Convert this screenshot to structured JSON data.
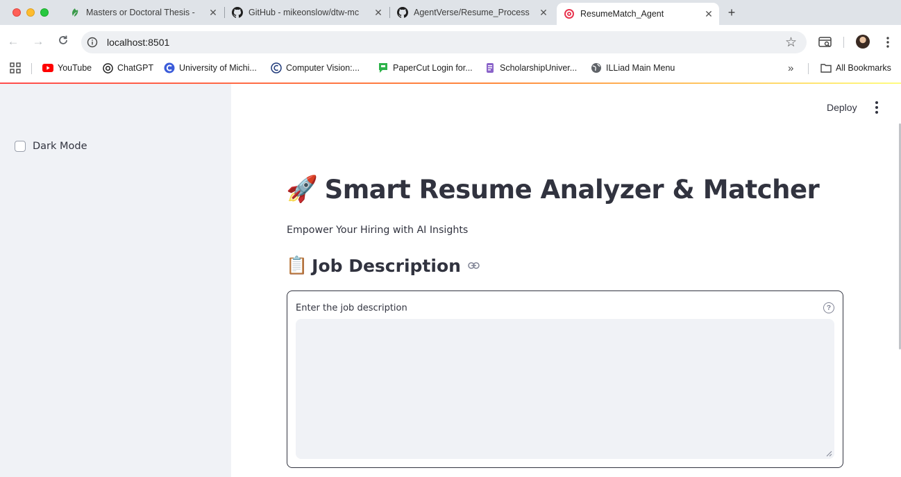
{
  "browser": {
    "tabs": [
      {
        "title": "Masters or Doctoral Thesis - ",
        "favicon": "overleaf-icon",
        "active": false
      },
      {
        "title": "GitHub - mikeonslow/dtw-mc",
        "favicon": "github-icon",
        "active": false
      },
      {
        "title": "AgentVerse/Resume_Process",
        "favicon": "github-icon",
        "active": false
      },
      {
        "title": "ResumeMatch_Agent",
        "favicon": "target-icon",
        "active": true
      }
    ],
    "url": "localhost:8501",
    "bookmarks": [
      {
        "label": "YouTube",
        "icon": "youtube-icon"
      },
      {
        "label": "ChatGPT",
        "icon": "chatgpt-icon"
      },
      {
        "label": "University of Michi...",
        "icon": "c-logo-icon"
      },
      {
        "label": "Computer Vision:...",
        "icon": "cv-logo-icon"
      },
      {
        "label": "PaperCut Login for...",
        "icon": "papercut-icon"
      },
      {
        "label": "ScholarshipUniver...",
        "icon": "scholarship-icon"
      },
      {
        "label": "ILLiad Main Menu",
        "icon": "globe-icon"
      }
    ],
    "all_bookmarks_label": "All Bookmarks"
  },
  "sidebar": {
    "dark_mode_label": "Dark Mode",
    "dark_mode_checked": false
  },
  "header": {
    "deploy_label": "Deploy"
  },
  "main": {
    "title_emoji": "🚀",
    "title": "Smart Resume Analyzer & Matcher",
    "subtitle": "Empower Your Hiring with AI Insights",
    "section_emoji": "📋",
    "section_title": "Job Description",
    "job_description": {
      "label": "Enter the job description",
      "value": ""
    }
  },
  "colors": {
    "sidebar_bg": "#f0f2f6",
    "text": "#31333f",
    "decoration_start": "#ff4b4b",
    "decoration_end": "#fffd80"
  }
}
